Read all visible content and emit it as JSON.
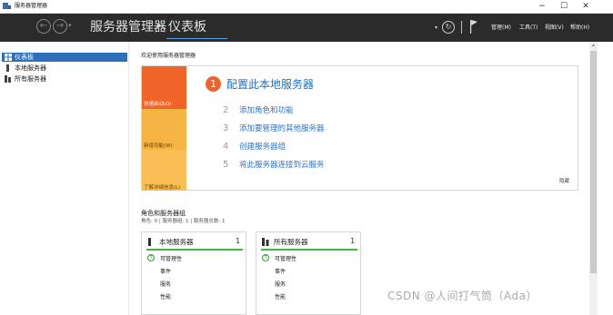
{
  "window": {
    "title": "服务器管理器",
    "controls": [
      "−",
      "☐",
      "✕"
    ]
  },
  "toolbar": {
    "breadcrumb_root": "服务器管理器",
    "breadcrumb_sep": "▸",
    "breadcrumb_current": "仪表板",
    "menus": [
      "管理(M)",
      "工具(T)",
      "视图(V)",
      "帮助(H)"
    ]
  },
  "sidebar": {
    "items": [
      {
        "label": "仪表板",
        "icon": "dashboard-icon",
        "active": true
      },
      {
        "label": "本地服务器",
        "icon": "server-icon",
        "active": false
      },
      {
        "label": "所有服务器",
        "icon": "servers-icon",
        "active": false
      }
    ]
  },
  "main": {
    "welcome_title": "欢迎使用服务器管理器",
    "quick_start": {
      "labels": [
        "快速启动(Q)",
        "新增功能(W)",
        "了解详细信息(L)"
      ],
      "main_step_num": "1",
      "main_step": "配置此本地服务器",
      "steps": [
        {
          "num": "2",
          "label": "添加角色和功能"
        },
        {
          "num": "3",
          "label": "添加要管理的其他服务器"
        },
        {
          "num": "4",
          "label": "创建服务器组"
        },
        {
          "num": "5",
          "label": "将此服务器连接到云服务"
        }
      ],
      "hide": "隐藏"
    },
    "roles": {
      "title": "角色和服务器组",
      "subtitle": "角色: 0 | 服务器组: 1 | 服务器总数: 1",
      "tiles": [
        {
          "title": "本地服务器",
          "count": "1",
          "rows": [
            "可管理性",
            "事件",
            "服务",
            "性能"
          ]
        },
        {
          "title": "所有服务器",
          "count": "1",
          "rows": [
            "可管理性",
            "事件",
            "服务",
            "性能"
          ]
        }
      ]
    }
  },
  "watermark": "CSDN @人间打气筒（Ada）",
  "colors": {
    "toolbar": "#2b2b2b",
    "accent": "#2d6fb8",
    "orange": "#f0642a",
    "yellow": "#f6b443",
    "green": "#3fb73f"
  }
}
